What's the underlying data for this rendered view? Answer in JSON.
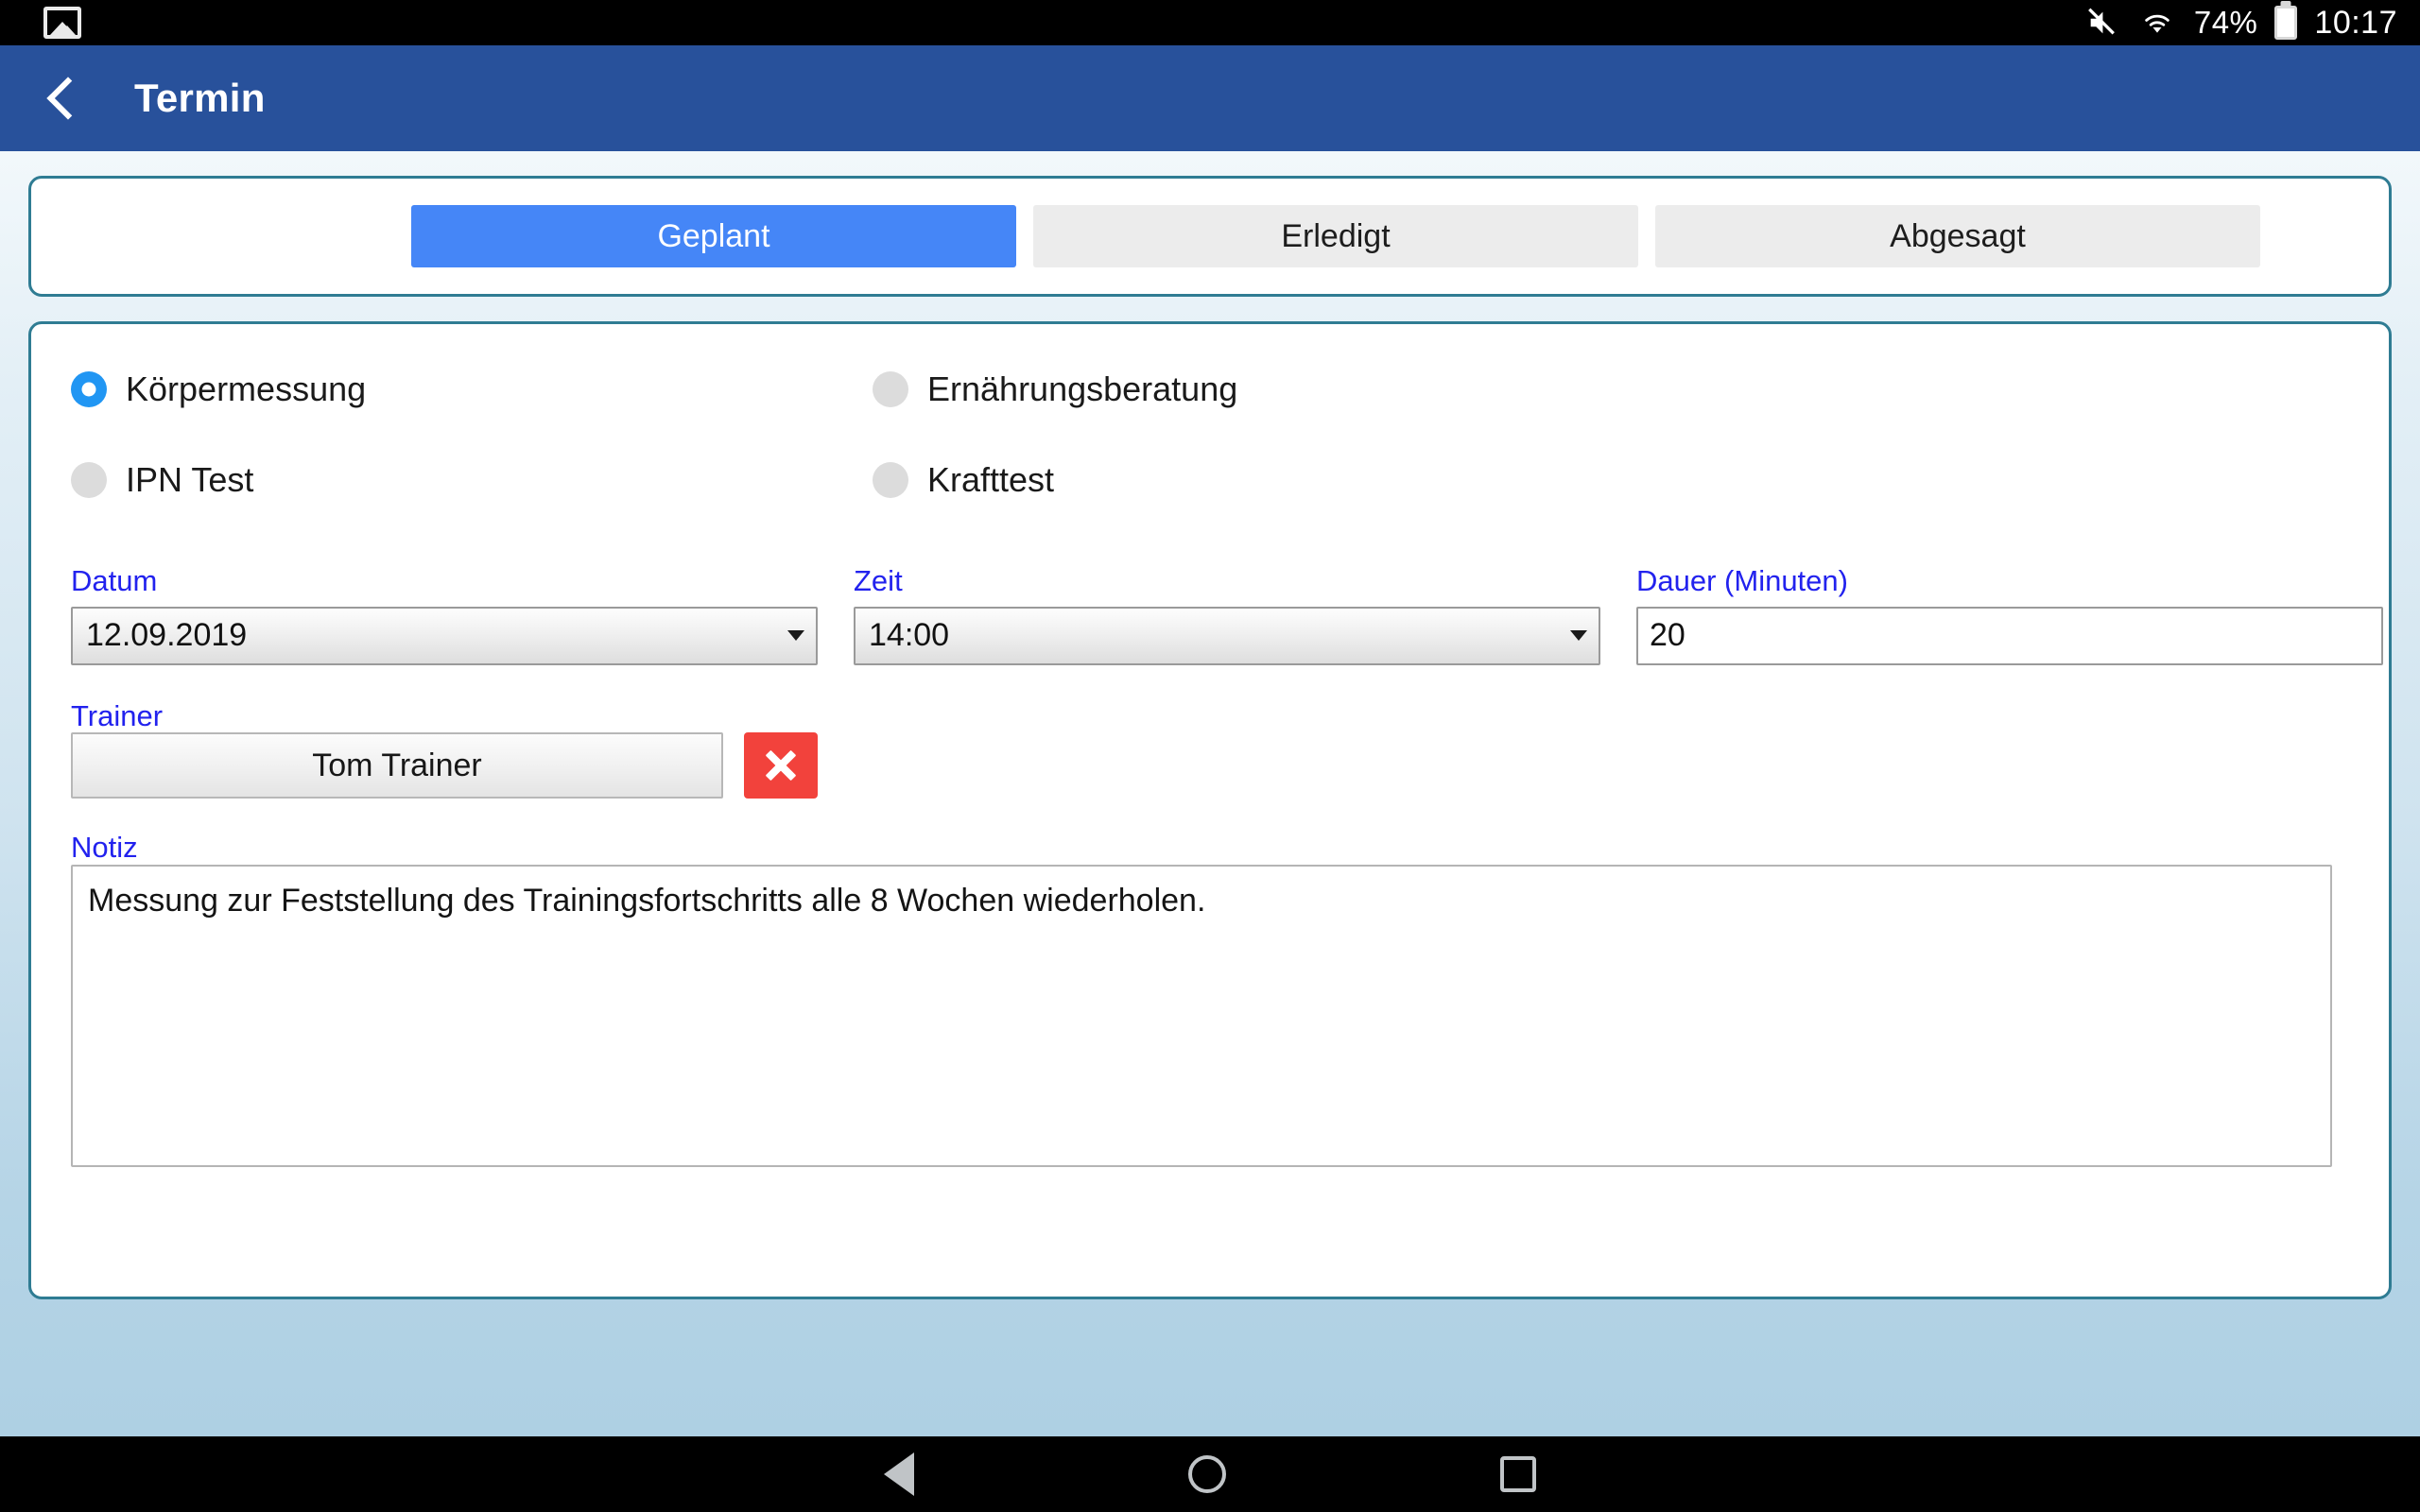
{
  "status_bar": {
    "gallery_icon": "image-icon",
    "mute_icon": "volume-mute-icon",
    "wifi_icon": "wifi-icon",
    "battery_percent": "74%",
    "battery_icon": "battery-icon",
    "clock": "10:17"
  },
  "header": {
    "back_icon": "back-chevron-icon",
    "title": "Termin",
    "background": "#28519b"
  },
  "tabs": {
    "items": [
      {
        "label": "Geplant",
        "active": true
      },
      {
        "label": "Erledigt",
        "active": false
      },
      {
        "label": "Abgesagt",
        "active": false
      }
    ],
    "active_color": "#4586f7",
    "inactive_color": "#ececec"
  },
  "appointment_type": {
    "options": [
      {
        "label": "Körpermessung",
        "selected": true
      },
      {
        "label": "Ernährungsberatung",
        "selected": false
      },
      {
        "label": "IPN Test",
        "selected": false
      },
      {
        "label": "Krafttest",
        "selected": false
      }
    ],
    "selected_color": "#2196f3",
    "unselected_color": "#dcdcdc"
  },
  "fields": {
    "datum": {
      "label": "Datum",
      "value": "12.09.2019",
      "type": "select"
    },
    "zeit": {
      "label": "Zeit",
      "value": "14:00",
      "type": "select"
    },
    "dauer": {
      "label": "Dauer (Minuten)",
      "value": "20",
      "type": "text"
    },
    "trainer": {
      "label": "Trainer",
      "value": "Tom Trainer",
      "delete_icon": "close-x-icon",
      "delete_color": "#f2423c"
    },
    "notiz": {
      "label": "Notiz",
      "value": "Messung zur Feststellung des Trainingsfortschritts alle 8 Wochen wiederholen."
    }
  },
  "label_color": "#2222ee",
  "nav_bar": {
    "back_icon": "nav-back-triangle-icon",
    "home_icon": "nav-home-circle-icon",
    "recents_icon": "nav-recents-square-icon"
  }
}
